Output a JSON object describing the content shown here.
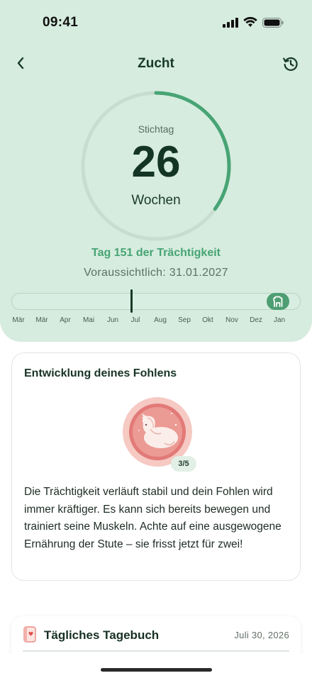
{
  "status": {
    "time": "09:41"
  },
  "nav": {
    "title": "Zucht"
  },
  "ring": {
    "label": "Stichtag",
    "value": "26",
    "unit": "Wochen",
    "progress": 0.35
  },
  "pregnancy": {
    "day_text": "Tag 151 der Trächtigkeit",
    "due_text": "Voraussichtlich: 31.01.2027"
  },
  "timeline": {
    "months": [
      "Mär",
      "Mär",
      "Apr",
      "Mai",
      "Jun",
      "Jul",
      "Aug",
      "Sep",
      "Okt",
      "Nov",
      "Dez",
      "Jan"
    ]
  },
  "development": {
    "title": "Entwicklung deines Fohlens",
    "progress_label": "3/5",
    "description": "Die Trächtigkeit verläuft stabil und dein Fohlen wird immer kräftiger. Es kann sich bereits bewegen und trainiert seine Muskeln. Achte auf eine ausgewogene Ernährung der Stute – sie frisst jetzt für zwei!"
  },
  "diary": {
    "title": "Tägliches Tagebuch",
    "date": "Juli 30, 2026"
  },
  "colors": {
    "hero_bg": "#d6ecdf",
    "accent": "#47a474",
    "ring_track": "#c7ddd0"
  },
  "icons": {
    "back": "chevron-left-icon",
    "history": "history-icon",
    "horse": "horse-icon",
    "diary": "diary-icon"
  }
}
